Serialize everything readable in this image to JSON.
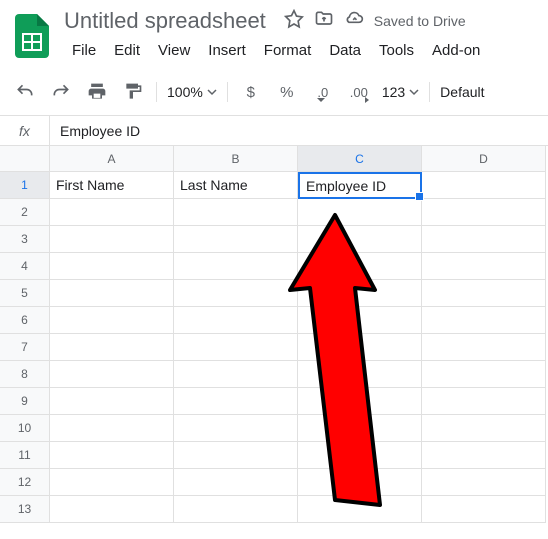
{
  "doc": {
    "title": "Untitled spreadsheet",
    "saved_status": "Saved to Drive"
  },
  "menu": {
    "file": "File",
    "edit": "Edit",
    "view": "View",
    "insert": "Insert",
    "format": "Format",
    "data": "Data",
    "tools": "Tools",
    "addons": "Add-on"
  },
  "toolbar": {
    "zoom": "100%",
    "currency": "$",
    "percent": "%",
    "dec_dec": ".0",
    "dec_inc": ".00",
    "num_fmt": "123",
    "font": "Default"
  },
  "formula": {
    "fx": "fx",
    "value": "Employee ID"
  },
  "columns": [
    "A",
    "B",
    "C",
    "D"
  ],
  "rows": [
    "1",
    "2",
    "3",
    "4",
    "5",
    "6",
    "7",
    "8",
    "9",
    "10",
    "11",
    "12",
    "13"
  ],
  "cells": {
    "A1": "First Name",
    "B1": "Last Name",
    "C1": "Employee ID"
  },
  "active_cell": "C1",
  "selected_col": "C",
  "selected_row": "1"
}
